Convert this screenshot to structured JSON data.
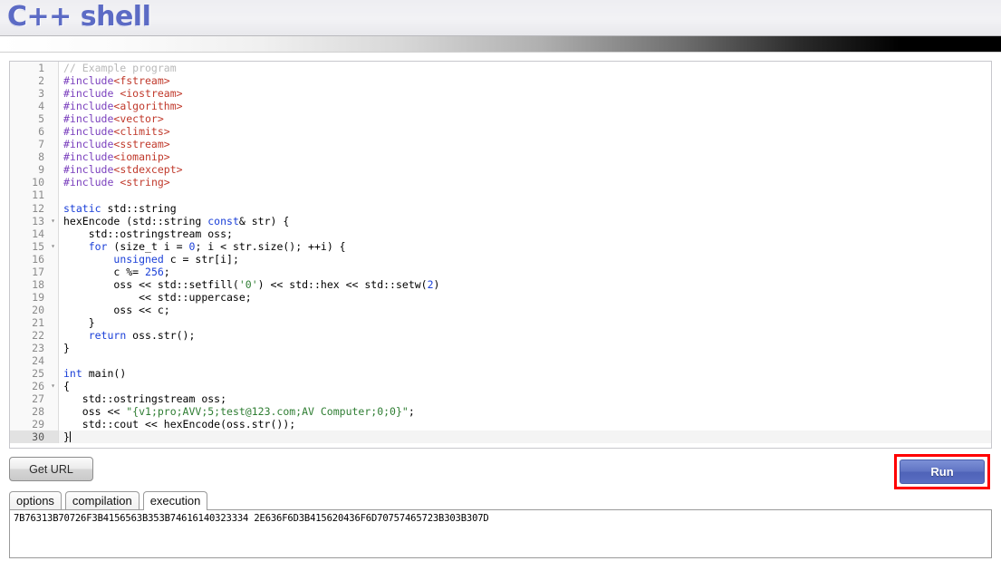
{
  "header": {
    "logo_text": "C++ shell"
  },
  "editor": {
    "lines": [
      {
        "n": "1",
        "fold": "",
        "active": false,
        "tokens": [
          {
            "t": "// Example program",
            "c": "c-comment"
          }
        ]
      },
      {
        "n": "2",
        "fold": "",
        "active": false,
        "tokens": [
          {
            "t": "#include",
            "c": "c-pre"
          },
          {
            "t": "<fstream>",
            "c": "c-header"
          }
        ]
      },
      {
        "n": "3",
        "fold": "",
        "active": false,
        "tokens": [
          {
            "t": "#include",
            "c": "c-pre"
          },
          {
            "t": " ",
            "c": "c-plain"
          },
          {
            "t": "<iostream>",
            "c": "c-header"
          }
        ]
      },
      {
        "n": "4",
        "fold": "",
        "active": false,
        "tokens": [
          {
            "t": "#include",
            "c": "c-pre"
          },
          {
            "t": "<algorithm>",
            "c": "c-header"
          }
        ]
      },
      {
        "n": "5",
        "fold": "",
        "active": false,
        "tokens": [
          {
            "t": "#include",
            "c": "c-pre"
          },
          {
            "t": "<vector>",
            "c": "c-header"
          }
        ]
      },
      {
        "n": "6",
        "fold": "",
        "active": false,
        "tokens": [
          {
            "t": "#include",
            "c": "c-pre"
          },
          {
            "t": "<climits>",
            "c": "c-header"
          }
        ]
      },
      {
        "n": "7",
        "fold": "",
        "active": false,
        "tokens": [
          {
            "t": "#include",
            "c": "c-pre"
          },
          {
            "t": "<sstream>",
            "c": "c-header"
          }
        ]
      },
      {
        "n": "8",
        "fold": "",
        "active": false,
        "tokens": [
          {
            "t": "#include",
            "c": "c-pre"
          },
          {
            "t": "<iomanip>",
            "c": "c-header"
          }
        ]
      },
      {
        "n": "9",
        "fold": "",
        "active": false,
        "tokens": [
          {
            "t": "#include",
            "c": "c-pre"
          },
          {
            "t": "<stdexcept>",
            "c": "c-header"
          }
        ]
      },
      {
        "n": "10",
        "fold": "",
        "active": false,
        "tokens": [
          {
            "t": "#include",
            "c": "c-pre"
          },
          {
            "t": " ",
            "c": "c-plain"
          },
          {
            "t": "<string>",
            "c": "c-header"
          }
        ]
      },
      {
        "n": "11",
        "fold": "",
        "active": false,
        "tokens": []
      },
      {
        "n": "12",
        "fold": "",
        "active": false,
        "tokens": [
          {
            "t": "static",
            "c": "c-kw"
          },
          {
            "t": " std::string",
            "c": "c-plain"
          }
        ]
      },
      {
        "n": "13",
        "fold": "▾",
        "active": false,
        "tokens": [
          {
            "t": "hexEncode (std::string ",
            "c": "c-plain"
          },
          {
            "t": "const",
            "c": "c-kw"
          },
          {
            "t": "& str) {",
            "c": "c-plain"
          }
        ]
      },
      {
        "n": "14",
        "fold": "",
        "active": false,
        "tokens": [
          {
            "t": "    std::ostringstream oss;",
            "c": "c-plain"
          }
        ]
      },
      {
        "n": "15",
        "fold": "▾",
        "active": false,
        "tokens": [
          {
            "t": "    ",
            "c": "c-plain"
          },
          {
            "t": "for",
            "c": "c-kw"
          },
          {
            "t": " (size_t i = ",
            "c": "c-plain"
          },
          {
            "t": "0",
            "c": "c-num"
          },
          {
            "t": "; i < str.size(); ++i) {",
            "c": "c-plain"
          }
        ]
      },
      {
        "n": "16",
        "fold": "",
        "active": false,
        "tokens": [
          {
            "t": "        ",
            "c": "c-plain"
          },
          {
            "t": "unsigned",
            "c": "c-kw"
          },
          {
            "t": " c = str[i];",
            "c": "c-plain"
          }
        ]
      },
      {
        "n": "17",
        "fold": "",
        "active": false,
        "tokens": [
          {
            "t": "        c %= ",
            "c": "c-plain"
          },
          {
            "t": "256",
            "c": "c-num"
          },
          {
            "t": ";",
            "c": "c-plain"
          }
        ]
      },
      {
        "n": "18",
        "fold": "",
        "active": false,
        "tokens": [
          {
            "t": "        oss << std::setfill(",
            "c": "c-plain"
          },
          {
            "t": "'0'",
            "c": "c-str"
          },
          {
            "t": ") << std::hex << std::setw(",
            "c": "c-plain"
          },
          {
            "t": "2",
            "c": "c-num"
          },
          {
            "t": ")",
            "c": "c-plain"
          }
        ]
      },
      {
        "n": "19",
        "fold": "",
        "active": false,
        "tokens": [
          {
            "t": "            << std::uppercase;",
            "c": "c-plain"
          }
        ]
      },
      {
        "n": "20",
        "fold": "",
        "active": false,
        "tokens": [
          {
            "t": "        oss << c;",
            "c": "c-plain"
          }
        ]
      },
      {
        "n": "21",
        "fold": "",
        "active": false,
        "tokens": [
          {
            "t": "    }",
            "c": "c-plain"
          }
        ]
      },
      {
        "n": "22",
        "fold": "",
        "active": false,
        "tokens": [
          {
            "t": "    ",
            "c": "c-plain"
          },
          {
            "t": "return",
            "c": "c-kw"
          },
          {
            "t": " oss.str();",
            "c": "c-plain"
          }
        ]
      },
      {
        "n": "23",
        "fold": "",
        "active": false,
        "tokens": [
          {
            "t": "}",
            "c": "c-plain"
          }
        ]
      },
      {
        "n": "24",
        "fold": "",
        "active": false,
        "tokens": []
      },
      {
        "n": "25",
        "fold": "",
        "active": false,
        "tokens": [
          {
            "t": "int",
            "c": "c-kw"
          },
          {
            "t": " main()",
            "c": "c-plain"
          }
        ]
      },
      {
        "n": "26",
        "fold": "▾",
        "active": false,
        "tokens": [
          {
            "t": "{",
            "c": "c-plain"
          }
        ]
      },
      {
        "n": "27",
        "fold": "",
        "active": false,
        "tokens": [
          {
            "t": "   std::ostringstream oss;",
            "c": "c-plain"
          }
        ]
      },
      {
        "n": "28",
        "fold": "",
        "active": false,
        "tokens": [
          {
            "t": "   oss << ",
            "c": "c-plain"
          },
          {
            "t": "\"{v1;pro;AVV;5;test@123.com;AV Computer;0;0}\"",
            "c": "c-str"
          },
          {
            "t": ";",
            "c": "c-plain"
          }
        ]
      },
      {
        "n": "29",
        "fold": "",
        "active": false,
        "tokens": [
          {
            "t": "   std::cout << hexEncode(oss.str());",
            "c": "c-plain"
          }
        ]
      },
      {
        "n": "30",
        "fold": "",
        "active": true,
        "tokens": [
          {
            "t": "}",
            "c": "c-plain"
          }
        ],
        "caret": true
      }
    ]
  },
  "actions": {
    "get_url_label": "Get URL",
    "run_label": "Run",
    "run_highlight_color": "#ff0000"
  },
  "tabs": {
    "items": [
      {
        "label": "options",
        "active": false
      },
      {
        "label": "compilation",
        "active": false
      },
      {
        "label": "execution",
        "active": true
      }
    ]
  },
  "output": {
    "text": "7B76313B70726F3B4156563B353B74616140323334 2E636F6D3B415620436F6D70757465723B303B307D"
  }
}
